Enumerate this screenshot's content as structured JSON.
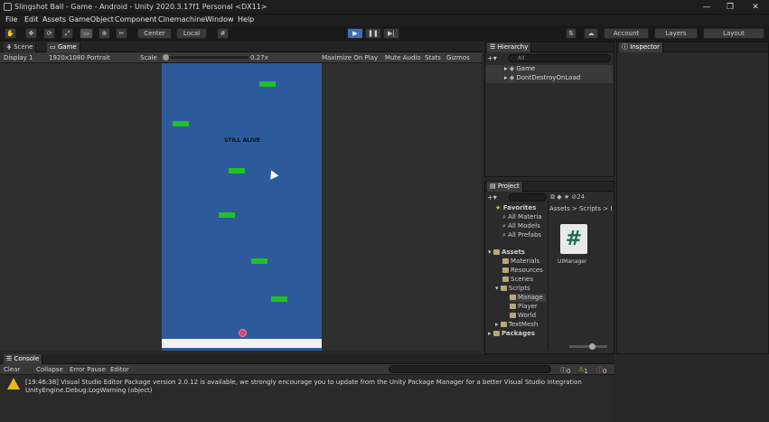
{
  "window": {
    "title": "Slingshot Ball - Game - Android - Unity 2020.3.17f1 Personal <DX11>",
    "minimize": "—",
    "maximize": "❐",
    "close": "✕"
  },
  "menu": [
    "File",
    "Edit",
    "Assets",
    "GameObject",
    "Component",
    "Cinemachine",
    "Window",
    "Help"
  ],
  "toolbar": {
    "pivot": "Center",
    "space": "Local",
    "account": "Account",
    "layers": "Layers",
    "layout": "Layout"
  },
  "tabs": {
    "scene": "Scene",
    "game": "Game",
    "hierarchy": "Hierarchy",
    "inspector": "Inspector",
    "project": "Project",
    "console": "Console"
  },
  "game_toolbar": {
    "display": "Display 1",
    "resolution": "1920x1080 Portrait",
    "scale_label": "Scale",
    "scale_value": "0.27x",
    "maximize_on_play": "Maximize On Play",
    "mute_audio": "Mute Audio",
    "stats": "Stats",
    "gizmos": "Gizmos"
  },
  "game": {
    "status_text": "STILL ALIVE"
  },
  "hierarchy": {
    "search_placeholder": "All",
    "items": [
      "Game",
      "DontDestroyOnLoad"
    ]
  },
  "project": {
    "search_placeholder": "",
    "count": "24",
    "favorites_label": "Favorites",
    "favorites": [
      "All Materia",
      "All Models",
      "All Prefabs"
    ],
    "assets_label": "Assets",
    "folders": [
      "Materials",
      "Resources",
      "Scenes",
      "Scripts",
      "Manage",
      "Player",
      "World",
      "TextMesh"
    ],
    "packages_label": "Packages",
    "breadcrumb": "Assets > Scripts > I",
    "file_name": "UIManager",
    "file_icon_glyph": "#"
  },
  "console": {
    "clear": "Clear",
    "collapse": "Collapse",
    "error_pause": "Error Pause",
    "editor": "Editor",
    "count_info": "0",
    "count_warn": "1",
    "count_error": "0",
    "message_line1": "[19:46:38] Visual Studio Editor Package version 2.0.12 is available, we strongly encourage you to update from the Unity Package Manager for a better Visual Studio integration",
    "message_line2": "UnityEngine.Debug:LogWarning (object)"
  },
  "colors": {
    "game_bg": "#2d5a9b",
    "platform": "#1fc128",
    "ball": "#d64a6b",
    "play_button": "#3e6cb5",
    "warning": "#e8b51f"
  }
}
